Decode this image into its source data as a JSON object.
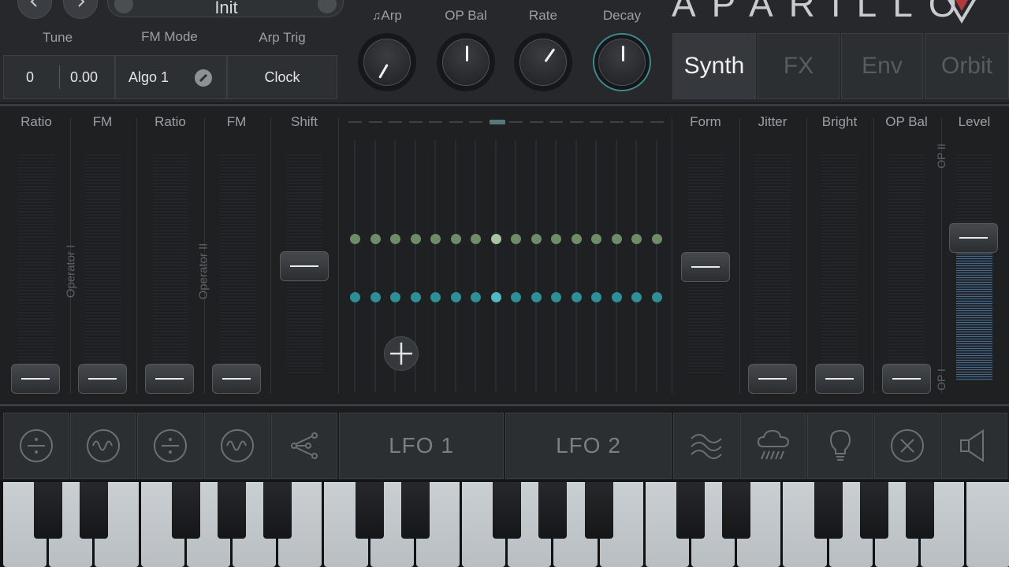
{
  "header": {
    "preset_name": "Init",
    "logo_text": "APARILLO",
    "labels": {
      "tune": "Tune",
      "fm_mode": "FM Mode",
      "arp_trig": "Arp Trig"
    },
    "values": {
      "coarse": "0",
      "fine": "0.00",
      "algo": "Algo 1",
      "clock": "Clock"
    },
    "knobs": [
      {
        "label": "Arp",
        "angle": 30
      },
      {
        "label": "OP Bal",
        "angle": 0
      },
      {
        "label": "Rate",
        "angle": 35
      },
      {
        "label": "Decay",
        "angle": 0
      }
    ],
    "tabs": [
      "Synth",
      "FX",
      "Env",
      "Orbit"
    ],
    "active_tab": "Synth"
  },
  "sliders": {
    "left": [
      "Ratio",
      "FM",
      "Ratio",
      "FM",
      "Shift"
    ],
    "right": [
      "Form",
      "Jitter",
      "Bright",
      "OP Bal",
      "Level"
    ],
    "operator_labels": [
      "Operator I",
      "Operator II"
    ],
    "level_side_labels": [
      "OP II",
      "OP I"
    ]
  },
  "sequencer": {
    "steps": 16,
    "active_step": 8
  },
  "toolbar": {
    "lfo1": "LFO 1",
    "lfo2": "LFO 2",
    "icons": [
      "divide-icon",
      "wave-icon",
      "divide-icon",
      "wave-icon",
      "share-icon",
      "waves-icon",
      "rain-cloud-icon",
      "lightbulb-icon",
      "close-circle-icon",
      "speaker-icon"
    ]
  }
}
